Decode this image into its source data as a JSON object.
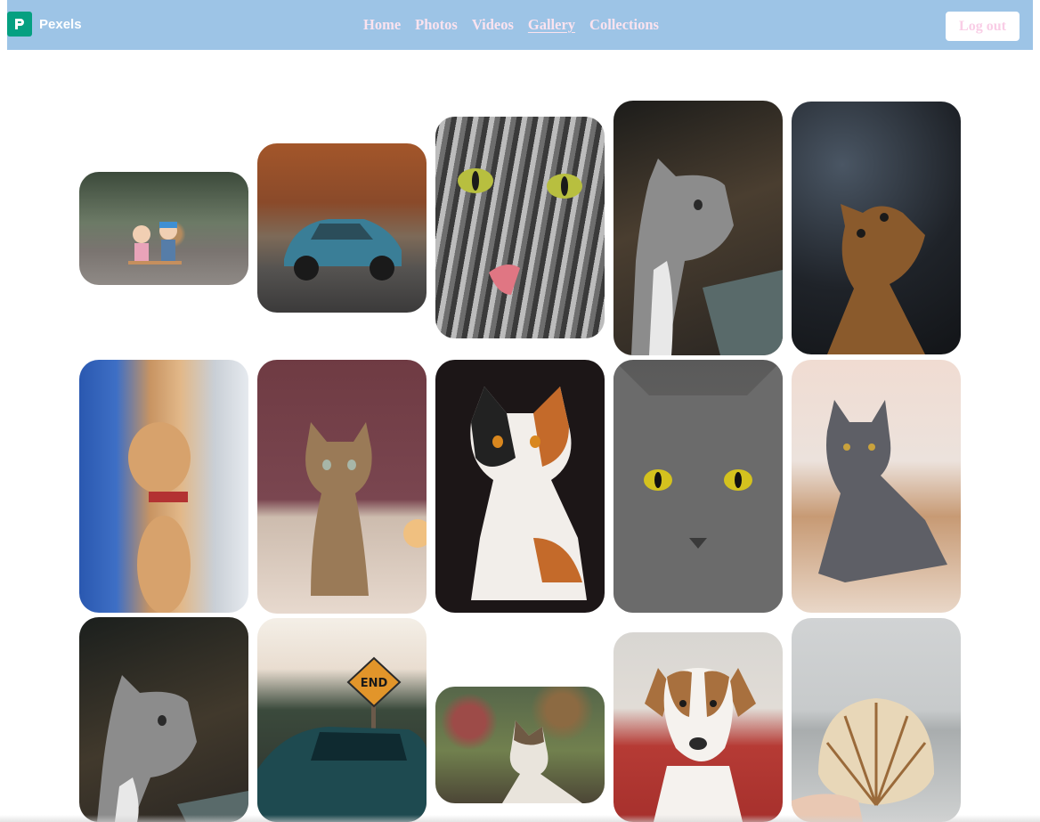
{
  "brand": {
    "name": "Pexels",
    "logo_icon": "pexels-logo-icon",
    "logo_color": "#05a081"
  },
  "nav": {
    "links": [
      {
        "label": "Home",
        "active": false
      },
      {
        "label": "Photos",
        "active": false
      },
      {
        "label": "Videos",
        "active": false
      },
      {
        "label": "Gallery",
        "active": true
      },
      {
        "label": "Collections",
        "active": false
      }
    ],
    "logout_label": "Log out"
  },
  "colors": {
    "navbar_bg": "#9dc4e6",
    "nav_text": "#fbe3ef",
    "logout_text": "#f9cde6"
  },
  "gallery": {
    "photos": [
      {
        "subject": "toy figurines on a seesaw",
        "tone": "#5f6a58"
      },
      {
        "subject": "blue vintage car on an autumn road",
        "tone": "#6b4b34"
      },
      {
        "subject": "tabby cat licking its paw",
        "tone": "#7f7f7f"
      },
      {
        "subject": "gray cat looking up",
        "tone": "#4a4438"
      },
      {
        "subject": "brown cat looking up",
        "tone": "#3a3a3a"
      },
      {
        "subject": "orange cat behind a blue curtain",
        "tone": "#c69a6a"
      },
      {
        "subject": "tabby kitten sitting",
        "tone": "#8d6b68"
      },
      {
        "subject": "calico cat lying down",
        "tone": "#2a2223"
      },
      {
        "subject": "gray cat with yellow eyes",
        "tone": "#5e5a58"
      },
      {
        "subject": "gray cat lying on a table",
        "tone": "#b9a79b"
      },
      {
        "subject": "gray cat looking up",
        "tone": "#3c3a34"
      },
      {
        "subject": "dark car under an END road sign",
        "tone": "#2f4a4b"
      },
      {
        "subject": "calico cat in a garden",
        "tone": "#6e5d4a"
      },
      {
        "subject": "brown and white dog on red cushion",
        "tone": "#b8a79c"
      },
      {
        "subject": "seashell held in a hand",
        "tone": "#c9cbcc"
      }
    ]
  }
}
